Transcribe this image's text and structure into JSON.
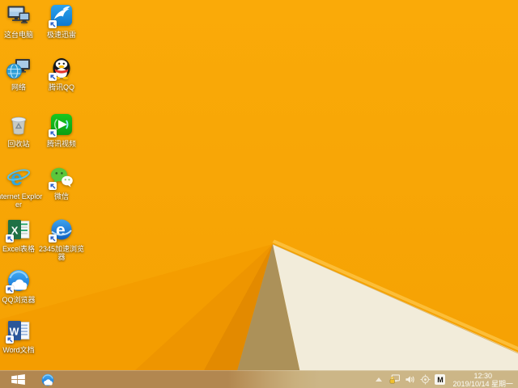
{
  "wallpaper": {
    "base_top": "#FAAA08",
    "base_bottom": "#F5A103",
    "facet_colors": [
      "#F49D00",
      "#EE9500",
      "#E38A00"
    ],
    "tan_facet": "#AC9159",
    "cream_facet": "#F2ECDA",
    "fold_highlight": "#FCBE39"
  },
  "desktop": {
    "icons": [
      {
        "label": "这台电脑"
      },
      {
        "label": "极速迅雷"
      },
      {
        "label": "网络"
      },
      {
        "label": "腾讯QQ"
      },
      {
        "label": "回收站"
      },
      {
        "label": "腾讯视频"
      },
      {
        "label": "Internet Explorer"
      },
      {
        "label": "微信"
      },
      {
        "label": "Excel表格"
      },
      {
        "label": "2345加速浏览器"
      },
      {
        "label": "QQ浏览器"
      },
      {
        "label": "Word文档"
      }
    ],
    "icon_glyphs": {
      "ie": "e",
      "excel": "X",
      "word": "W",
      "browser2345": "e"
    }
  },
  "taskbar": {
    "tray": {
      "ime_indicator": "M",
      "time": "12:30",
      "date": "2019/10/14 星期一"
    }
  }
}
